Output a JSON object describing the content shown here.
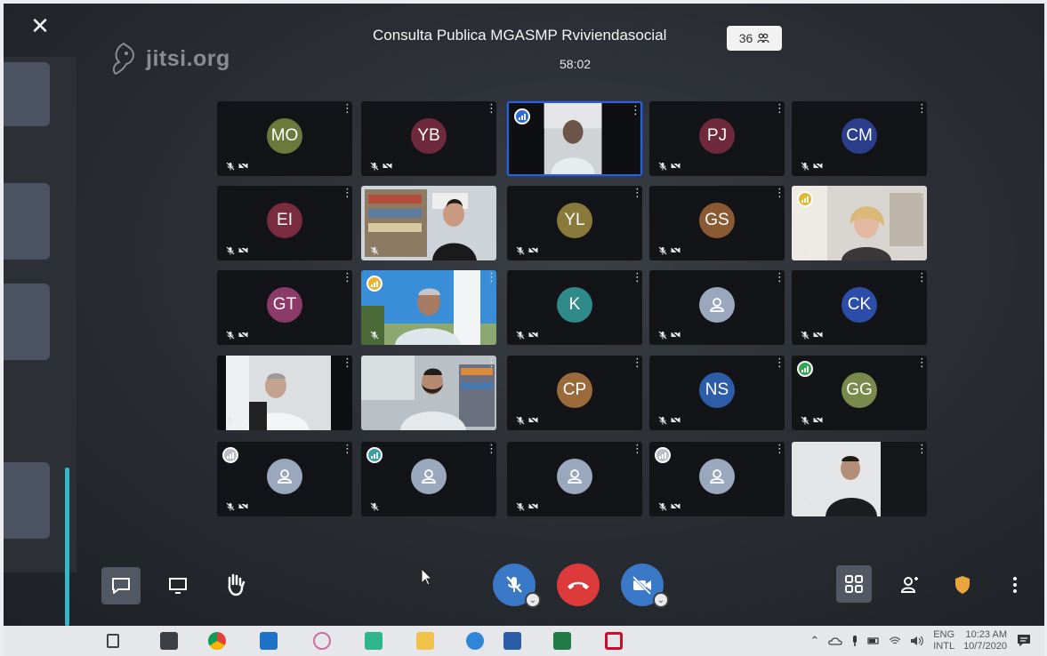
{
  "app": {
    "logo_text": "jitsi.org"
  },
  "header": {
    "meeting_title": "Consulta Publica MGASMP Rviviendasocial",
    "participant_count": "36",
    "timer": "58:02"
  },
  "tiles": [
    {
      "type": "avatar",
      "initials": "MO",
      "color": "#6b7a3a",
      "muted": true,
      "video_off": true
    },
    {
      "type": "avatar",
      "initials": "YB",
      "color": "#6e2a3c",
      "muted": true,
      "video_off": true
    },
    {
      "type": "video",
      "scene": "person-dark",
      "active": true,
      "indicator": "blue",
      "muted": false,
      "video_off": false
    },
    {
      "type": "avatar",
      "initials": "PJ",
      "color": "#6e2a3c",
      "muted": true,
      "video_off": true
    },
    {
      "type": "avatar",
      "initials": "CM",
      "color": "#2b3e8c",
      "muted": true,
      "video_off": true
    },
    {
      "type": "avatar",
      "initials": "EI",
      "color": "#7a2d3e",
      "muted": true,
      "video_off": true
    },
    {
      "type": "video",
      "scene": "bookshelf-woman",
      "muted": true,
      "video_off": false
    },
    {
      "type": "avatar",
      "initials": "YL",
      "color": "#8a7a3a",
      "muted": true,
      "video_off": true
    },
    {
      "type": "avatar",
      "initials": "GS",
      "color": "#8a5a32",
      "muted": true,
      "video_off": true
    },
    {
      "type": "video",
      "scene": "blonde-woman",
      "indicator": "yellow",
      "muted": true,
      "video_off": false
    },
    {
      "type": "avatar",
      "initials": "GT",
      "color": "#8c3a6a",
      "muted": true,
      "video_off": true
    },
    {
      "type": "video",
      "scene": "outdoor-man",
      "indicator": "yellow",
      "muted": true,
      "video_off": false
    },
    {
      "type": "avatar",
      "initials": "K",
      "color": "#2f8a8a",
      "muted": true,
      "video_off": true
    },
    {
      "type": "avatar",
      "initials": "",
      "generic": true,
      "muted": true,
      "video_off": true
    },
    {
      "type": "avatar",
      "initials": "CK",
      "color": "#2d4ea8",
      "muted": true,
      "video_off": true
    },
    {
      "type": "video",
      "scene": "office-man",
      "muted": true,
      "video_off": false
    },
    {
      "type": "video",
      "scene": "bearded-man",
      "muted": false,
      "video_off": false
    },
    {
      "type": "avatar",
      "initials": "CP",
      "color": "#9a6a3a",
      "muted": true,
      "video_off": true
    },
    {
      "type": "avatar",
      "initials": "NS",
      "color": "#2d5ca8",
      "muted": true,
      "video_off": true
    },
    {
      "type": "avatar",
      "initials": "GG",
      "color": "#7a8a4a",
      "indicator": "green",
      "muted": true,
      "video_off": true
    },
    {
      "type": "avatar",
      "initials": "",
      "generic": true,
      "indicator": "gray",
      "muted": true,
      "video_off": true
    },
    {
      "type": "avatar",
      "initials": "",
      "generic": true,
      "indicator": "teal",
      "muted": true,
      "video_off": false
    },
    {
      "type": "avatar",
      "initials": "",
      "generic": true,
      "muted": true,
      "video_off": true
    },
    {
      "type": "avatar",
      "initials": "",
      "generic": true,
      "indicator": "gray",
      "muted": true,
      "video_off": true
    },
    {
      "type": "video",
      "scene": "man-dark-jacket",
      "muted": true,
      "video_off": false
    }
  ],
  "toolbar": {
    "left": [
      "chat-icon",
      "screenshare-icon",
      "raise-hand-icon"
    ],
    "center": [
      "mic-muted-icon",
      "hangup-icon",
      "camera-off-icon"
    ],
    "right": [
      "tile-view-icon",
      "invite-icon",
      "security-icon",
      "more-icon"
    ]
  },
  "taskbar": {
    "apps": [
      "task-view-icon",
      "store-icon",
      "chrome-icon",
      "mail-icon",
      "snipping-icon",
      "app-icon",
      "file-explorer-icon",
      "vpn-icon",
      "word-icon",
      "excel-icon",
      "mcafee-icon"
    ],
    "lang_top": "ENG",
    "lang_bottom": "INTL",
    "time": "10:23 AM",
    "date": "10/7/2020"
  },
  "colors": {
    "accent_blue": "#2f5fd0",
    "hangup_red": "#dd3b3b",
    "toolbar_blue": "#3a78c8",
    "scroll_teal": "#38b6c9",
    "shield": "#e9a43a"
  }
}
